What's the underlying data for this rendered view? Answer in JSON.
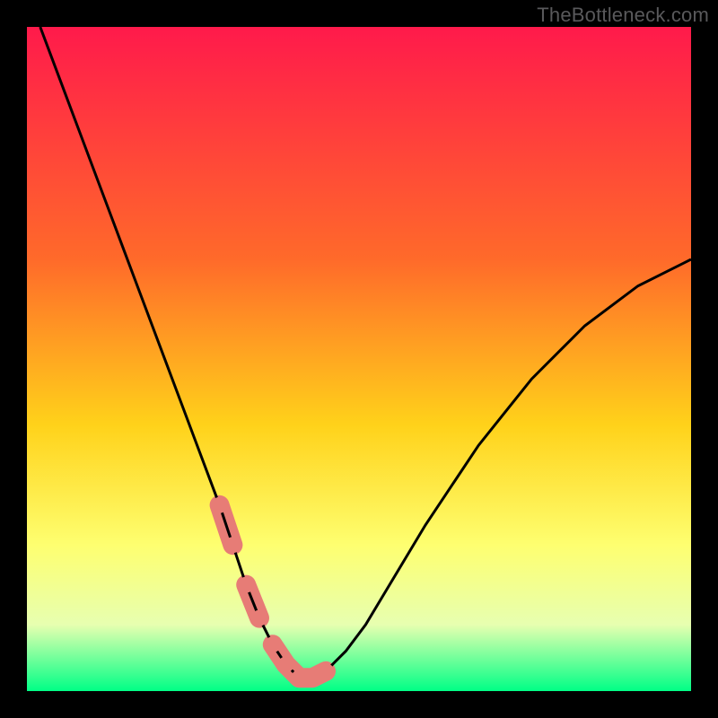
{
  "watermark": "TheBottleneck.com",
  "colors": {
    "frame": "#000000",
    "grad_top": "#ff1a4b",
    "grad_mid1": "#ff6a2a",
    "grad_mid2": "#ffd21a",
    "grad_mid3": "#feff70",
    "grad_mid4": "#e7ffb0",
    "grad_bot": "#00ff86",
    "curve": "#000000",
    "marker": "#e77c76"
  },
  "chart_data": {
    "type": "line",
    "title": "",
    "xlabel": "",
    "ylabel": "",
    "xlim": [
      0,
      100
    ],
    "ylim": [
      0,
      100
    ],
    "series": [
      {
        "name": "bottleneck-curve",
        "x": [
          2,
          5,
          8,
          11,
          14,
          17,
          20,
          23,
          26,
          29,
          31,
          33,
          35,
          37,
          39,
          41,
          43,
          45,
          48,
          51,
          54,
          57,
          60,
          64,
          68,
          72,
          76,
          80,
          84,
          88,
          92,
          96,
          100
        ],
        "y": [
          100,
          92,
          84,
          76,
          68,
          60,
          52,
          44,
          36,
          28,
          22,
          16,
          11,
          7,
          4,
          2,
          2,
          3,
          6,
          10,
          15,
          20,
          25,
          31,
          37,
          42,
          47,
          51,
          55,
          58,
          61,
          63,
          65
        ]
      }
    ],
    "markers": {
      "name": "highlight-points",
      "x": [
        29,
        31,
        33,
        35,
        37,
        39,
        41,
        43,
        45
      ],
      "y": [
        28,
        22,
        16,
        11,
        7,
        4,
        2,
        2,
        3
      ],
      "sausage_segments": [
        {
          "from": 0,
          "to": 1
        },
        {
          "from": 2,
          "to": 3
        },
        {
          "from": 4,
          "to": 8
        }
      ]
    }
  }
}
